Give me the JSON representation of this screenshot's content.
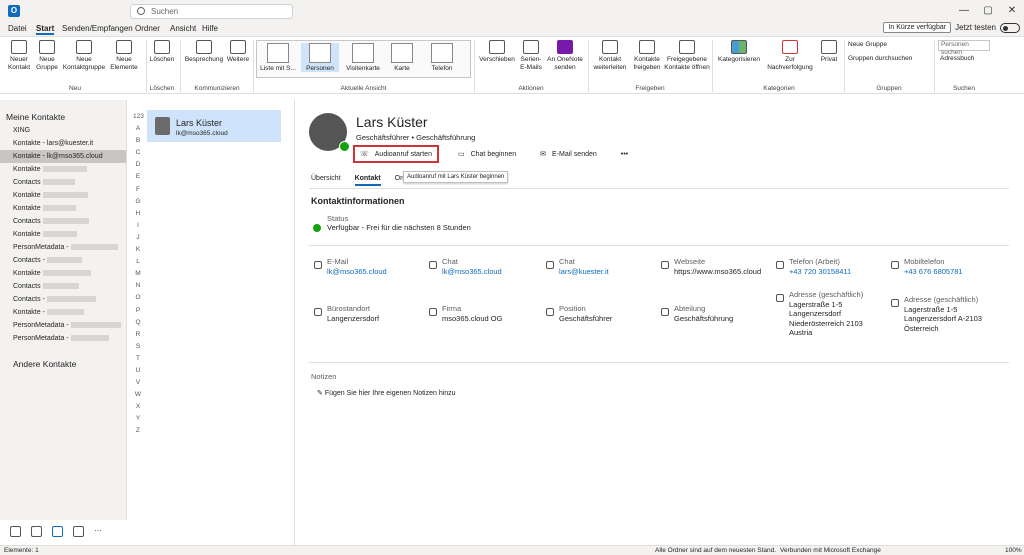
{
  "app": {
    "logo": "O",
    "search_placeholder": "Suchen",
    "win_controls": [
      "—",
      "▢",
      "✕"
    ]
  },
  "menu": {
    "items": [
      "Datei",
      "Start",
      "Senden/Empfangen",
      "Ordner",
      "Ansicht",
      "Hilfe"
    ],
    "active": "Start",
    "soon": "In Kürze verfügbar",
    "try_now": "Jetzt testen"
  },
  "ribbon": {
    "neu": {
      "group": "Neu",
      "buttons": [
        "Neuer Kontakt",
        "Neue Gruppe",
        "Neue Kontaktgruppe",
        "Neue Elemente"
      ]
    },
    "loeschen": {
      "group": "Löschen",
      "buttons": [
        "Löschen"
      ]
    },
    "komm": {
      "group": "Kommunizieren",
      "buttons": [
        "Besprechung",
        "Weitere"
      ]
    },
    "view": {
      "group": "Aktuelle Ansicht",
      "buttons": [
        "Liste mit S...",
        "Personen",
        "Visitenkarte",
        "Karte",
        "Telefon"
      ],
      "selected": "Personen"
    },
    "aktionen": {
      "group": "Aktionen",
      "buttons": [
        "Verschieben",
        "Serien-E-Mails",
        "An OneNote senden"
      ]
    },
    "freigeben": {
      "group": "Freigeben",
      "buttons": [
        "Kontakt weiterleiten",
        "Kontakte freigeben",
        "Freigegebene Kontakte öffnen"
      ]
    },
    "kategorien": {
      "group": "Kategorien",
      "buttons": [
        "Kategorisieren",
        "Zur Nachverfolgung",
        "Privat"
      ]
    },
    "gruppen": {
      "group": "Gruppen",
      "buttons": [
        "Neue Gruppe",
        "Gruppen durchsuchen"
      ]
    },
    "suchen": {
      "group": "Suchen",
      "input_placeholder": "Personen suchen",
      "buttons": [
        "Adressbuch"
      ]
    }
  },
  "nav": {
    "header": "Meine Kontakte",
    "items": [
      "XING",
      "Kontakte - lars@kuester.it",
      "Kontakte - lk@mso365.cloud",
      "Kontakte",
      "Contacts",
      "Kontakte",
      "Kontakte",
      "Contacts",
      "Kontakte",
      "PersonMetadata -",
      "Contacts -",
      "Kontakte",
      "Contacts",
      "Contacts -",
      "Kontakte -",
      "PersonMetadata -",
      "PersonMetadata -"
    ],
    "selected_index": 2,
    "other": "Andere Kontakte"
  },
  "alpha": [
    "123",
    "A",
    "B",
    "C",
    "D",
    "E",
    "F",
    "G",
    "H",
    "I",
    "J",
    "K",
    "L",
    "M",
    "N",
    "O",
    "P",
    "Q",
    "R",
    "S",
    "T",
    "U",
    "V",
    "W",
    "X",
    "Y",
    "Z"
  ],
  "contact_list": [
    {
      "name": "Lars Küster",
      "email": "lk@mso365.cloud"
    }
  ],
  "detail": {
    "name": "Lars Küster",
    "job": "Geschäftsführer • Geschäftsführung",
    "actions": [
      "Audioanruf starten",
      "Chat beginnen",
      "E-Mail senden",
      "•••"
    ],
    "tooltip": "Audioanruf mit Lars Küster beginnen",
    "tabs": [
      "Übersicht",
      "Kontakt",
      "Org",
      "edIn"
    ],
    "active_tab": "Kontakt",
    "section": "Kontaktinformationen",
    "status_label": "Status",
    "status_value": "Verfügbar - Frei für die nächsten 8 Stunden",
    "fields": [
      {
        "label": "E-Mail",
        "value": "lk@mso365.cloud",
        "link": true
      },
      {
        "label": "Chat",
        "value": "lk@mso365.cloud",
        "link": true
      },
      {
        "label": "Chat",
        "value": "lars@kuester.it",
        "link": true
      },
      {
        "label": "Webseite",
        "value": "https://www.mso365.cloud",
        "link": false
      },
      {
        "label": "Telefon (Arbeit)",
        "value": "+43 720 30158411",
        "link": true
      },
      {
        "label": "Mobiltelefon",
        "value": "+43 676 6805781",
        "link": true
      },
      {
        "label": "Bürostandort",
        "value": "Langenzersdorf",
        "link": false
      },
      {
        "label": "Firma",
        "value": "mso365.cloud OG",
        "link": false
      },
      {
        "label": "Position",
        "value": "Geschäftsführer",
        "link": false
      },
      {
        "label": "Abteilung",
        "value": "Geschäftsführung",
        "link": false
      },
      {
        "label": "Adresse (geschäftlich)",
        "value": "Lagerstraße 1-5\nLangenzersdorf\nNiederösterreich 2103\nAustria",
        "link": false
      },
      {
        "label": "Adresse (geschäftlich)",
        "value": "Lagerstraße 1-5\nLangenzersdorf A-2103\nÖsterreich",
        "link": false
      }
    ],
    "notes_label": "Notizen",
    "notes_add": "Fügen Sie hier Ihre eigenen Notizen hinzu"
  },
  "statusbar": {
    "left": "Elemente: 1",
    "sync": "Alle Ordner sind auf dem neuesten Stand.",
    "conn": "Verbunden mit Microsoft Exchange",
    "zoom": "100%"
  },
  "colors": {
    "accent": "#0f6cbd",
    "status_green": "#13a10e",
    "highlight": "#d13438"
  }
}
